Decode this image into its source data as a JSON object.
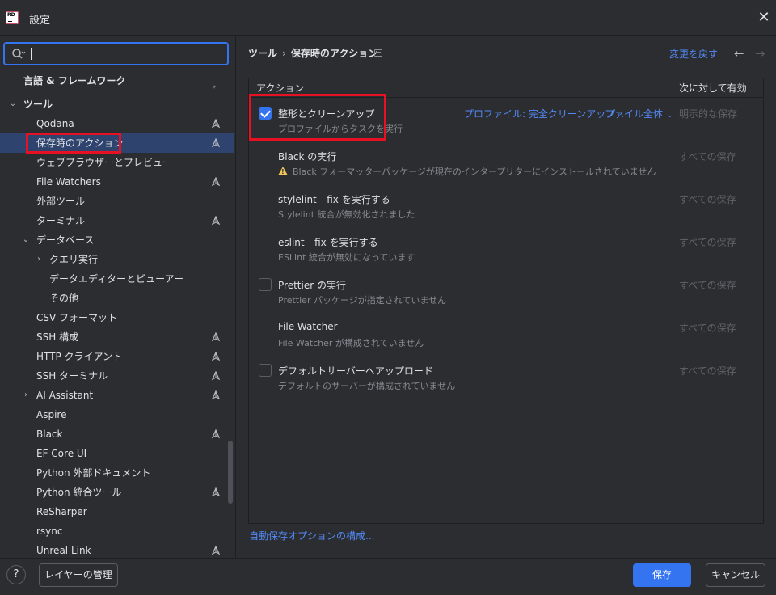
{
  "window": {
    "title": "設定",
    "logo_text": "RD",
    "close_glyph": "✕"
  },
  "search": {
    "value": "",
    "placeholder": ""
  },
  "sidebar": {
    "items": [
      {
        "label": "言語 & フレームワーク"
      },
      {
        "label": "ツール"
      },
      {
        "label": "Qodana"
      },
      {
        "label": "保存時のアクション"
      },
      {
        "label": "ウェブブラウザーとプレビュー"
      },
      {
        "label": "File Watchers"
      },
      {
        "label": "外部ツール"
      },
      {
        "label": "ターミナル"
      },
      {
        "label": "データベース"
      },
      {
        "label": "クエリ実行"
      },
      {
        "label": "データエディターとビューアー"
      },
      {
        "label": "その他"
      },
      {
        "label": "CSV フォーマット"
      },
      {
        "label": "SSH 構成"
      },
      {
        "label": "HTTP クライアント"
      },
      {
        "label": "SSH ターミナル"
      },
      {
        "label": "AI Assistant"
      },
      {
        "label": "Aspire"
      },
      {
        "label": "Black"
      },
      {
        "label": "EF Core UI"
      },
      {
        "label": "Python 外部ドキュメント"
      },
      {
        "label": "Python 統合ツール"
      },
      {
        "label": "ReSharper"
      },
      {
        "label": "rsync"
      },
      {
        "label": "Unreal Link"
      }
    ]
  },
  "header": {
    "crumb_parent": "ツール",
    "crumb_sep": "›",
    "crumb_current": "保存時のアクション",
    "reset_label": "変更を戻す",
    "back_glyph": "←",
    "forward_glyph": "→"
  },
  "table": {
    "col_action": "アクション",
    "col_scope": "次に対して有効",
    "actions": [
      {
        "title": "整形とクリーンアップ",
        "subtitle": "プロファイルからタスクを実行",
        "scope": "明示的な保存",
        "checked": true,
        "profile_dropdown": "プロファイル: 完全クリーンアップ",
        "range_dropdown": "ファイル全体"
      },
      {
        "title": "Black の実行",
        "subtitle": "Black フォーマッターパッケージが現在のインタープリターにインストールされていません",
        "scope": "すべての保存",
        "warning": true
      },
      {
        "title": "stylelint --fix を実行する",
        "subtitle": "Stylelint 統合が無効化されました",
        "scope": "すべての保存"
      },
      {
        "title": "eslint --fix を実行する",
        "subtitle": "ESLint 統合が無効になっています",
        "scope": "すべての保存"
      },
      {
        "title": "Prettier の実行",
        "subtitle": "Prettier パッケージが指定されていません",
        "scope": "すべての保存",
        "checked": false
      },
      {
        "title": "File Watcher",
        "subtitle": "File Watcher が構成されていません",
        "scope": "すべての保存"
      },
      {
        "title": "デフォルトサーバーへアップロード",
        "subtitle": "デフォルトのサーバーが構成されていません",
        "scope": "すべての保存",
        "checked": false
      }
    ]
  },
  "config_link": "自動保存オプションの構成...",
  "footer": {
    "help": "?",
    "layers_button": "レイヤーの管理",
    "save_button": "保存",
    "cancel_button": "キャンセル"
  },
  "colors": {
    "accent": "#3574f0",
    "link": "#548af7",
    "highlight_box": "#e81123",
    "selection": "#2e436e"
  }
}
